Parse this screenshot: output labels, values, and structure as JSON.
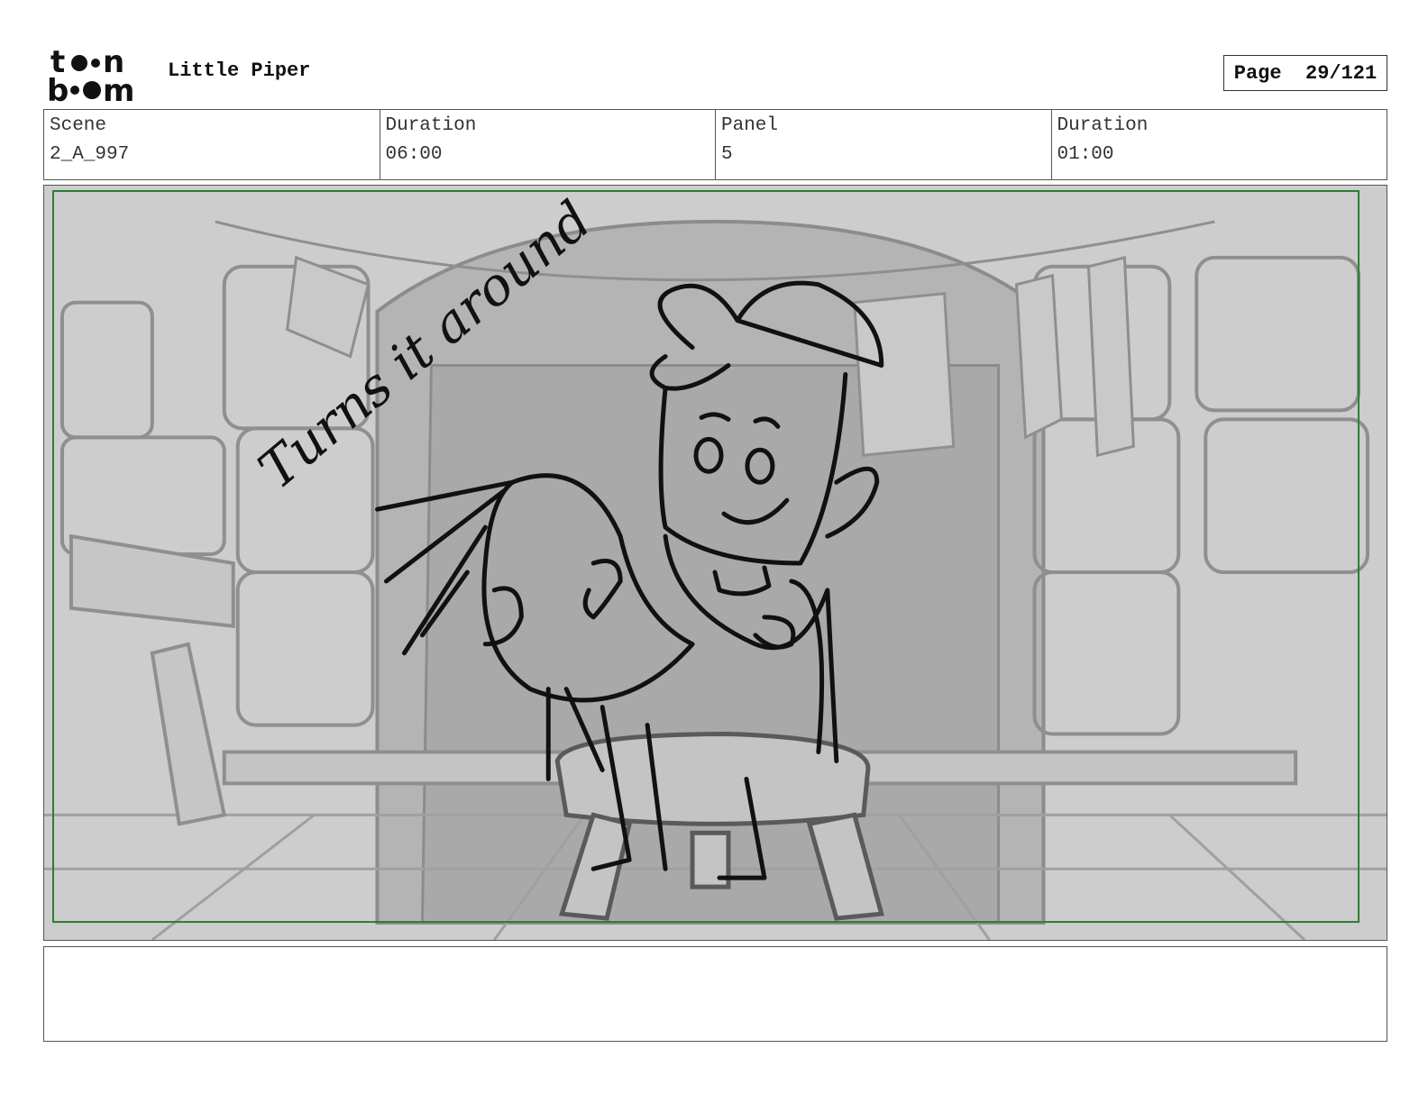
{
  "header": {
    "logo_text_top": "t••n",
    "logo_text_bottom": "b••m",
    "project_title": "Little Piper",
    "page_label": "Page",
    "page_number": "29/121"
  },
  "info": {
    "scene_label": "Scene",
    "scene_value": "2_A_997",
    "scene_duration_label": "Duration",
    "scene_duration_value": "06:00",
    "panel_label": "Panel",
    "panel_value": "5",
    "panel_duration_label": "Duration",
    "panel_duration_value": "01:00"
  },
  "panel": {
    "annotation": "Turns it around",
    "safe_frame_color": "#2e7d32"
  },
  "notes": {
    "text": ""
  }
}
